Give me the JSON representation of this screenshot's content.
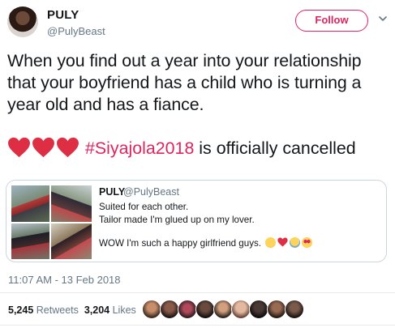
{
  "author": {
    "name": "PULY",
    "handle": "@PulyBeast"
  },
  "follow_button": {
    "label": "Follow"
  },
  "tweet": {
    "text": "When you find out a year into your relationship that your boyfriend has a child who is turning a year old and has a fiance.",
    "hashtag": "#Siyajola2018",
    "suffix": " is officially cancelled",
    "heart_color": "#e0245e"
  },
  "quoted": {
    "name": "PULY",
    "handle": "@PulyBeast",
    "lines": [
      "Suited for each other.",
      "Tailor made I'm glued up on my lover.",
      "",
      "WOW I'm such a happy girlfriend guys."
    ]
  },
  "meta": {
    "timestamp": "11:07 AM - 13 Feb 2018"
  },
  "stats": {
    "retweets_count": "5,245",
    "retweets_label": "Retweets",
    "likes_count": "3,204",
    "likes_label": "Likes"
  },
  "colors": {
    "accent": "#e0245e",
    "muted": "#657786",
    "border": "#ccd6dd"
  }
}
